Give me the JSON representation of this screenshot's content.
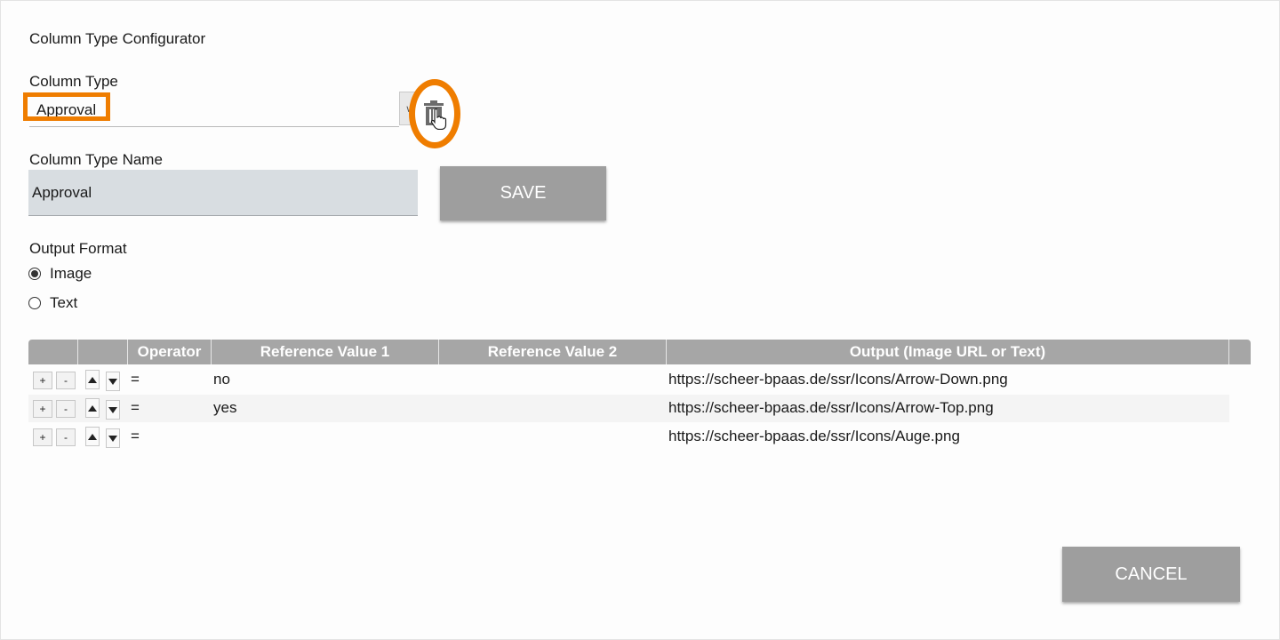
{
  "title": "Column Type Configurator",
  "column_type": {
    "label": "Column Type",
    "selected": "Approval",
    "dropdown_icon": "chevron-down-icon",
    "delete_icon": "trash-icon"
  },
  "column_type_name": {
    "label": "Column Type Name",
    "value": "Approval"
  },
  "buttons": {
    "save": "SAVE",
    "cancel": "CANCEL"
  },
  "output_format": {
    "label": "Output Format",
    "options": [
      {
        "label": "Image",
        "checked": true
      },
      {
        "label": "Text",
        "checked": false
      }
    ]
  },
  "table": {
    "headers": [
      "",
      "",
      "Operator",
      "Reference Value 1",
      "Reference Value 2",
      "Output (Image URL or Text)"
    ],
    "add_label": "+",
    "remove_label": "-",
    "rows": [
      {
        "operator": "=",
        "ref1": "no",
        "ref2": "",
        "output": "https://scheer-bpaas.de/ssr/Icons/Arrow-Down.png"
      },
      {
        "operator": "=",
        "ref1": "yes",
        "ref2": "",
        "output": "https://scheer-bpaas.de/ssr/Icons/Arrow-Top.png"
      },
      {
        "operator": "=",
        "ref1": "",
        "ref2": "",
        "output": "https://scheer-bpaas.de/ssr/Icons/Auge.png"
      }
    ]
  },
  "colors": {
    "highlight": "#ef7d00",
    "button_bg": "#9e9e9e",
    "header_bg": "#a6a6a6",
    "input_bg": "#d8dde1"
  }
}
